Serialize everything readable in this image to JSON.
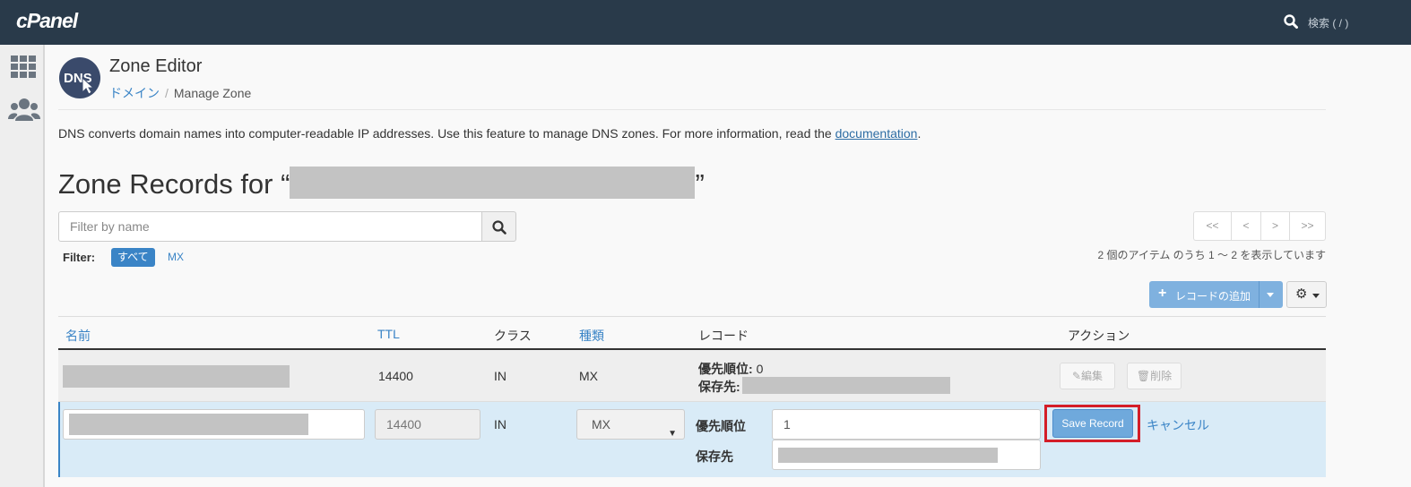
{
  "topbar": {
    "logo": "cPanel",
    "search_label": "検索 ( / )"
  },
  "header": {
    "app_title": "Zone Editor",
    "breadcrumb": {
      "parent": "ドメイン",
      "separator": "/",
      "current": "Manage Zone"
    }
  },
  "description": {
    "text": "DNS converts domain names into computer-readable IP addresses. Use this feature to manage DNS zones. For more information, read the ",
    "link": "documentation",
    "suffix": "."
  },
  "zone": {
    "title_prefix": "Zone Records for “",
    "title_suffix": "”"
  },
  "filter": {
    "placeholder": "Filter by name",
    "label": "Filter:",
    "options": [
      "すべて",
      "MX"
    ],
    "active": "すべて"
  },
  "pagination": {
    "first": "<<",
    "prev": "<",
    "next": ">",
    "last": ">>",
    "summary": "2 個のアイテム のうち 1 〜 2 を表示しています"
  },
  "toolbar": {
    "add_record_label": "レコードの追加"
  },
  "table": {
    "headers": {
      "name": "名前",
      "ttl": "TTL",
      "class": "クラス",
      "type": "種類",
      "record": "レコード",
      "actions": "アクション"
    },
    "rows": [
      {
        "ttl": "14400",
        "class": "IN",
        "type": "MX",
        "priority_label": "優先順位:",
        "priority_value": "0",
        "destination_label": "保存先:",
        "edit_label": "編集",
        "delete_label": "削除"
      }
    ],
    "edit_row": {
      "ttl": "14400",
      "class": "IN",
      "type": "MX",
      "priority_label": "優先順位",
      "priority_value": "1",
      "destination_label": "保存先",
      "save_label": "Save Record",
      "cancel_label": "キャンセル"
    }
  },
  "colors": {
    "topbar": "#293a4a",
    "link": "#3a84c6",
    "highlight_outline": "#d31d28",
    "edit_row_bg": "#d9ebf7"
  }
}
